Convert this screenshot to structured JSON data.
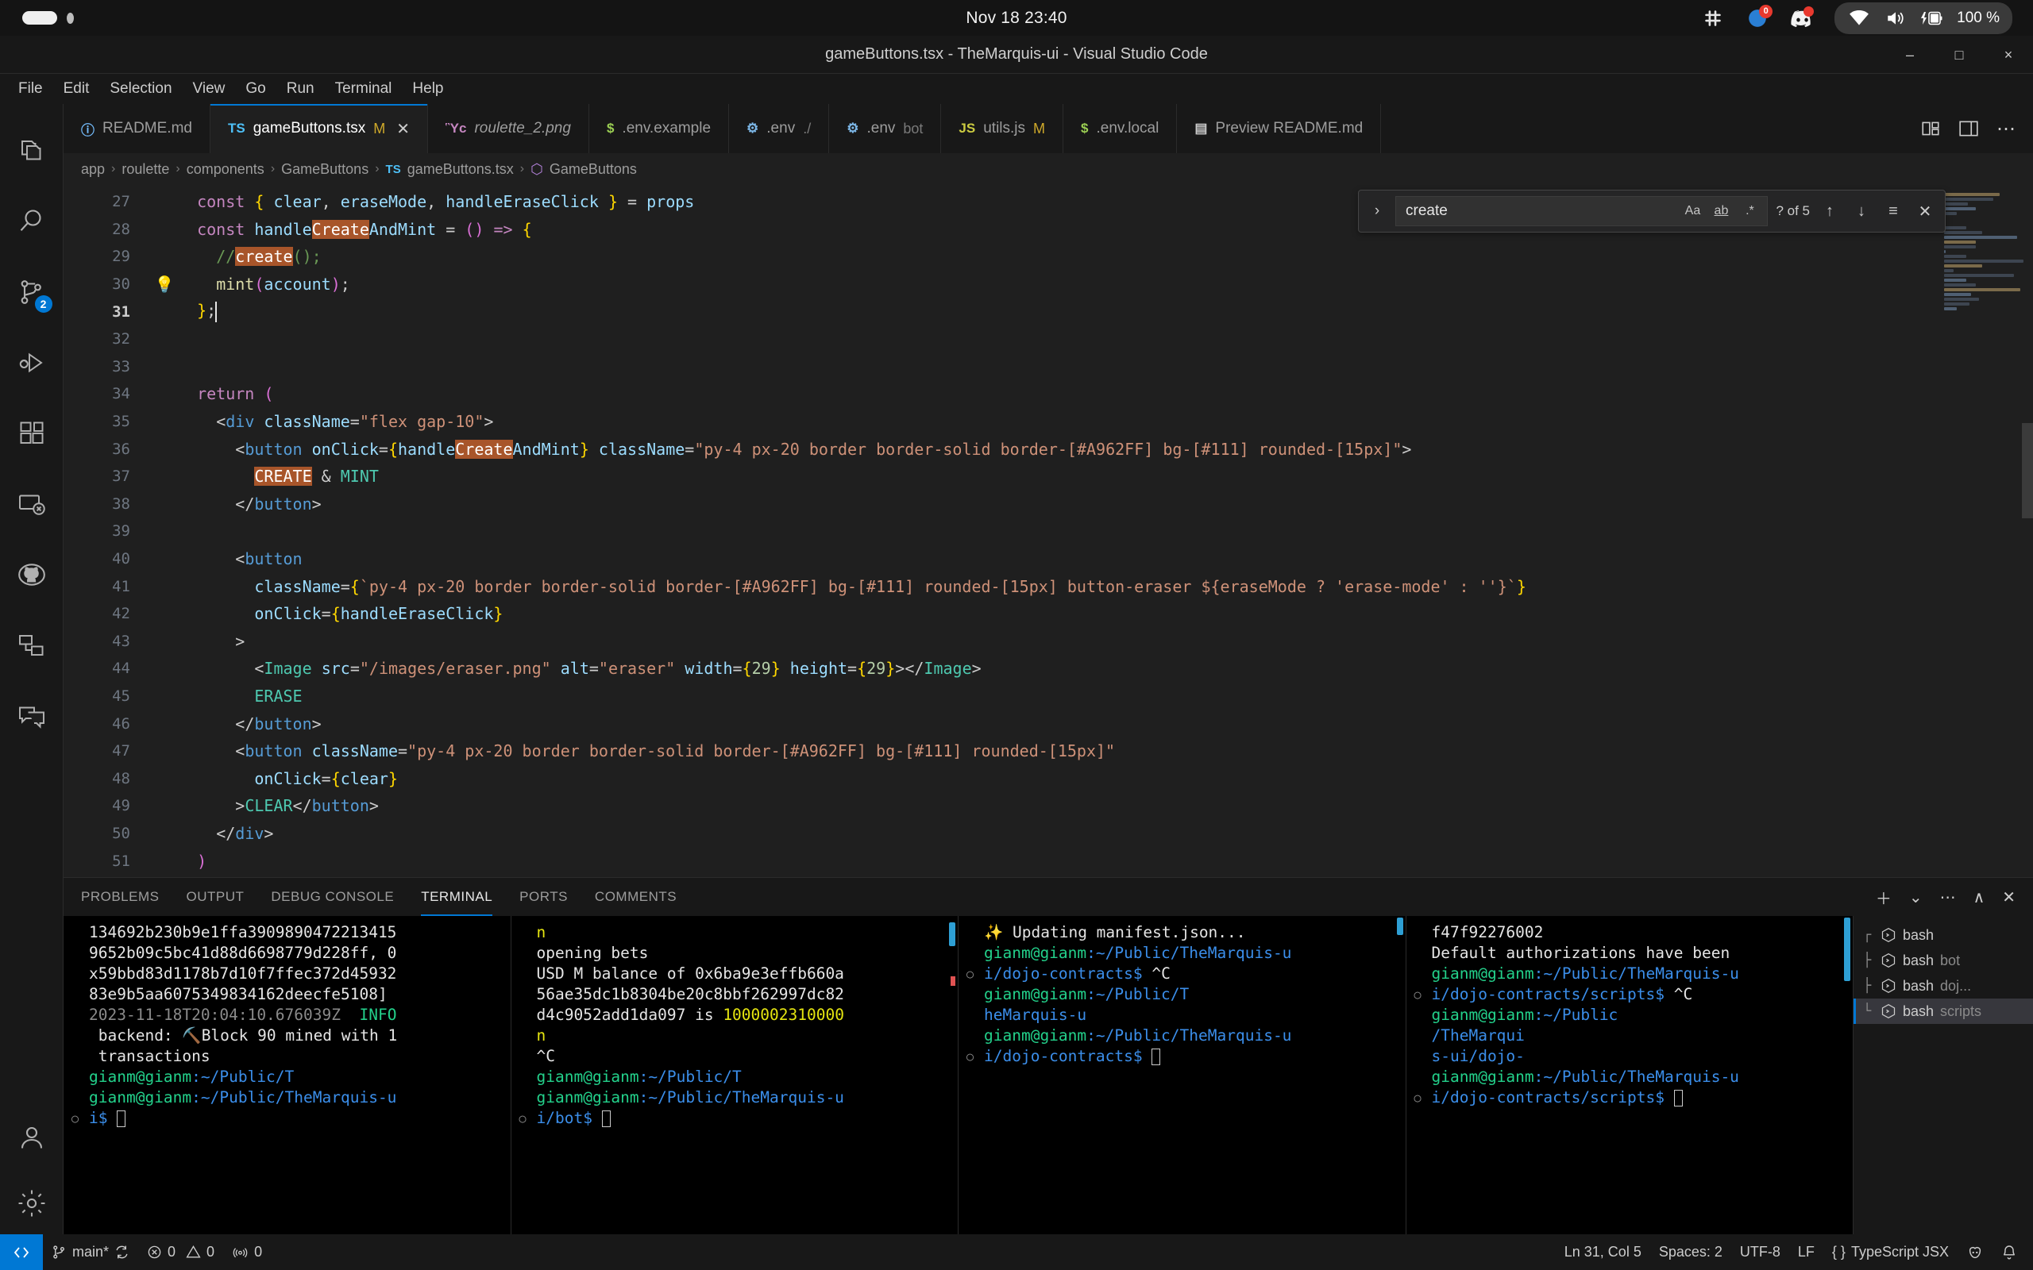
{
  "os_bar": {
    "clock": "Nov 18 23:40",
    "tray": [
      {
        "name": "slack-icon",
        "badge": null
      },
      {
        "name": "notification-badge-icon",
        "badge": "0"
      },
      {
        "name": "discord-icon",
        "badge": ""
      },
      {
        "name": "wifi-icon",
        "badge": null
      },
      {
        "name": "volume-icon",
        "badge": null
      },
      {
        "name": "battery-icon",
        "badge": null
      }
    ],
    "battery_label": "100 %"
  },
  "window": {
    "title": "gameButtons.tsx - TheMarquis-ui - Visual Studio Code",
    "minimize": "–",
    "maximize": "□",
    "close": "×"
  },
  "menubar": [
    "File",
    "Edit",
    "Selection",
    "View",
    "Go",
    "Run",
    "Terminal",
    "Help"
  ],
  "activitybar": [
    {
      "name": "explorer-icon",
      "badge": null
    },
    {
      "name": "search-icon",
      "badge": null
    },
    {
      "name": "source-control-icon",
      "badge": "2"
    },
    {
      "name": "run-and-debug-icon",
      "badge": null
    },
    {
      "name": "extensions-icon",
      "badge": null
    },
    {
      "name": "remote-explorer-icon",
      "badge": null
    },
    {
      "name": "github-icon",
      "badge": null
    },
    {
      "name": "testing-icon",
      "badge": null
    },
    {
      "name": "comments-icon",
      "badge": null
    }
  ],
  "activitybar_bottom": [
    {
      "name": "accounts-icon"
    },
    {
      "name": "settings-gear-icon"
    }
  ],
  "tabs": [
    {
      "icon": "info-icon",
      "icon_text": "ⓘ",
      "icon_color": "#75beff",
      "name": "README.md",
      "modified": "",
      "desc": "",
      "active": false,
      "closable": false,
      "italic": false
    },
    {
      "icon": "typescript-icon",
      "icon_text": "TS",
      "icon_color": "#4ec0f7",
      "name": "gameButtons.tsx",
      "modified": "M",
      "desc": "",
      "active": true,
      "closable": true,
      "italic": false
    },
    {
      "icon": "image-icon",
      "icon_text": "Ὓc",
      "icon_color": "#c586c0",
      "name": "roulette_2.png",
      "modified": "",
      "desc": "",
      "active": false,
      "closable": false,
      "italic": true
    },
    {
      "icon": "env-icon",
      "icon_text": "$",
      "icon_color": "#9bcf53",
      "name": ".env.example",
      "modified": "",
      "desc": "",
      "active": false,
      "closable": false,
      "italic": false
    },
    {
      "icon": "gear-icon",
      "icon_text": "⚙",
      "icon_color": "#7cb7e8",
      "name": ".env",
      "modified": "",
      "desc": "./",
      "active": false,
      "closable": false,
      "italic": false
    },
    {
      "icon": "gear-icon",
      "icon_text": "⚙",
      "icon_color": "#7cb7e8",
      "name": ".env",
      "modified": "",
      "desc": "bot",
      "active": false,
      "closable": false,
      "italic": false
    },
    {
      "icon": "javascript-icon",
      "icon_text": "JS",
      "icon_color": "#cbcb41",
      "name": "utils.js",
      "modified": "M",
      "desc": "",
      "active": false,
      "closable": false,
      "italic": false
    },
    {
      "icon": "env-icon",
      "icon_text": "$",
      "icon_color": "#9bcf53",
      "name": ".env.local",
      "modified": "",
      "desc": "",
      "active": false,
      "closable": false,
      "italic": false
    },
    {
      "icon": "preview-icon",
      "icon_text": "▤",
      "icon_color": "#cccccc",
      "name": "Preview README.md",
      "modified": "",
      "desc": "",
      "active": false,
      "closable": false,
      "italic": false
    }
  ],
  "tabbar_actions": [
    {
      "name": "split-editor-icon"
    },
    {
      "name": "toggle-layout-icon"
    },
    {
      "name": "more-actions-icon"
    }
  ],
  "breadcrumb": [
    "app",
    "roulette",
    "components",
    "GameButtons",
    "gameButtons.tsx",
    "GameButtons"
  ],
  "find_widget": {
    "toggle_replace": "›",
    "query": "create",
    "match_case": "Aa",
    "whole_word": "ab",
    "regex": ".*",
    "results": "? of 5",
    "prev": "↑",
    "next": "↓",
    "find_in_selection": "≡",
    "close": "✕"
  },
  "editor": {
    "first_line": 27,
    "current_line": 31,
    "lines": [
      {
        "n": 27,
        "text": "  const { clear, eraseMode, handleEraseClick } = props"
      },
      {
        "n": 28,
        "text": "  const handleCreateAndMint = () => {"
      },
      {
        "n": 29,
        "text": "    //create();"
      },
      {
        "n": 30,
        "text": "    mint(account);"
      },
      {
        "n": 31,
        "text": "  };"
      },
      {
        "n": 32,
        "text": ""
      },
      {
        "n": 33,
        "text": ""
      },
      {
        "n": 34,
        "text": "  return ("
      },
      {
        "n": 35,
        "text": "    <div className=\"flex gap-10\">"
      },
      {
        "n": 36,
        "text": "      <button onClick={handleCreateAndMint} className=\"py-4 px-20 border border-solid border-[#A962FF] bg-[#111] rounded-[15px]\">"
      },
      {
        "n": 37,
        "text": "        CREATE & MINT"
      },
      {
        "n": 38,
        "text": "      </button>"
      },
      {
        "n": 39,
        "text": ""
      },
      {
        "n": 40,
        "text": "      <button"
      },
      {
        "n": 41,
        "text": "        className={`py-4 px-20 border border-solid border-[#A962FF] bg-[#111] rounded-[15px] button-eraser ${eraseMode ? 'erase-mode' : ''}`}"
      },
      {
        "n": 42,
        "text": "        onClick={handleEraseClick}"
      },
      {
        "n": 43,
        "text": "      >"
      },
      {
        "n": 44,
        "text": "        <Image src=\"/images/eraser.png\" alt=\"eraser\" width={29} height={29}></Image>"
      },
      {
        "n": 45,
        "text": "        ERASE"
      },
      {
        "n": 46,
        "text": "      </button>"
      },
      {
        "n": 47,
        "text": "      <button className=\"py-4 px-20 border border-solid border-[#A962FF] bg-[#111] rounded-[15px]\""
      },
      {
        "n": 48,
        "text": "        onClick={clear}"
      },
      {
        "n": 49,
        "text": "      >CLEAR</button>"
      },
      {
        "n": 50,
        "text": "    </div>"
      },
      {
        "n": 51,
        "text": "  )"
      }
    ],
    "lightbulb_line": 30
  },
  "panel": {
    "tabs": [
      {
        "label": "PROBLEMS",
        "active": false
      },
      {
        "label": "OUTPUT",
        "active": false
      },
      {
        "label": "DEBUG CONSOLE",
        "active": false
      },
      {
        "label": "TERMINAL",
        "active": true
      },
      {
        "label": "PORTS",
        "active": false
      },
      {
        "label": "COMMENTS",
        "active": false
      }
    ],
    "actions": [
      {
        "name": "new-terminal-icon",
        "glyph": "＋"
      },
      {
        "name": "terminal-dropdown-icon",
        "glyph": "⌄"
      },
      {
        "name": "panel-more-actions-icon",
        "glyph": "⋯"
      },
      {
        "name": "maximize-panel-icon",
        "glyph": "∧"
      },
      {
        "name": "close-panel-icon",
        "glyph": "✕"
      }
    ]
  },
  "terminals": [
    {
      "name": "bash",
      "lines": [
        [
          {
            "t": "134692b230b9e1ffa3909890472213415",
            "c": "t-white"
          }
        ],
        [
          {
            "t": "9652b09c5bc41d88d6698779d228ff, 0",
            "c": "t-white"
          }
        ],
        [
          {
            "t": "x59bbd83d1178b7d10f7ffec372d45932",
            "c": "t-white"
          }
        ],
        [
          {
            "t": "83e9b5aa6075349834162deecfe5108]",
            "c": "t-white"
          }
        ],
        [
          {
            "t": "2023-11-18T20:04:10.676039Z ",
            "c": "t-gray"
          },
          {
            "t": " INFO",
            "c": "t-green"
          }
        ],
        [
          {
            "t": " backend: ⛏️Block 90 mined with 1",
            "c": "t-white"
          }
        ],
        [
          {
            "t": " transactions",
            "c": "t-white"
          }
        ],
        [
          {
            "t": "gianm@gianm",
            "c": "t-green"
          },
          {
            "t": ":~/Public/T",
            "c": "t-blue"
          }
        ],
        [
          {
            "t": "gianm@gianm",
            "c": "t-green"
          },
          {
            "t": ":~/Public/TheMarquis-u",
            "c": "t-blue"
          }
        ],
        [
          {
            "t": "i$ ",
            "c": "t-blue",
            "mark": true,
            "cursor": true
          }
        ]
      ]
    },
    {
      "name": "bash bot",
      "lines": [
        [
          {
            "t": "n",
            "c": "t-yellow"
          }
        ],
        [
          {
            "t": "opening bets",
            "c": "t-white"
          }
        ],
        [
          {
            "t": "USD M balance of 0x6ba9e3effb660a",
            "c": "t-white"
          }
        ],
        [
          {
            "t": "56ae35dc1b8304be20c8bbf262997dc82",
            "c": "t-white"
          }
        ],
        [
          {
            "t": "d4c9052add1da097 is ",
            "c": "t-white"
          },
          {
            "t": "1000002310000",
            "c": "t-yellow"
          }
        ],
        [
          {
            "t": "n",
            "c": "t-yellow"
          }
        ],
        [
          {
            "t": "^C",
            "c": "t-white"
          }
        ],
        [
          {
            "t": "gianm@gianm",
            "c": "t-green"
          },
          {
            "t": ":~/Public/T",
            "c": "t-blue"
          }
        ],
        [
          {
            "t": "gianm@gianm",
            "c": "t-green"
          },
          {
            "t": ":~/Public/TheMarquis-u",
            "c": "t-blue"
          }
        ],
        [
          {
            "t": "i/bot$ ",
            "c": "t-blue",
            "mark": true,
            "cursor": true
          }
        ]
      ]
    },
    {
      "name": "bash doj...",
      "lines": [
        [
          {
            "t": "",
            "c": "t-white"
          }
        ],
        [
          {
            "t": "✨ Updating manifest.json...",
            "c": "t-white"
          }
        ],
        [
          {
            "t": "",
            "c": "t-white"
          }
        ],
        [
          {
            "t": "gianm@gianm",
            "c": "t-green"
          },
          {
            "t": ":~/Public/TheMarquis-u",
            "c": "t-blue"
          }
        ],
        [
          {
            "t": "i/dojo-contracts$ ",
            "c": "t-blue",
            "mark": true
          },
          {
            "t": "^C",
            "c": "t-white"
          }
        ],
        [
          {
            "t": "gianm@gianm",
            "c": "t-green"
          },
          {
            "t": ":~/Public/T",
            "c": "t-blue"
          }
        ],
        [
          {
            "t": "heMarquis-u",
            "c": "t-blue"
          }
        ],
        [
          {
            "t": "gianm@gianm",
            "c": "t-green"
          },
          {
            "t": ":~/Public/TheMarquis-u",
            "c": "t-blue"
          }
        ],
        [
          {
            "t": "i/dojo-contracts$ ",
            "c": "t-blue",
            "mark": true,
            "cursor": true
          }
        ]
      ]
    },
    {
      "name": "bash scripts",
      "lines": [
        [
          {
            "t": "f47f92276002",
            "c": "t-white"
          }
        ],
        [
          {
            "t": "Default authorizations have been",
            "c": "t-white"
          }
        ],
        [
          {
            "t": "gianm@gianm",
            "c": "t-green"
          },
          {
            "t": ":~/Public/TheMarquis-u",
            "c": "t-blue"
          }
        ],
        [
          {
            "t": "i/dojo-contracts/scripts$ ",
            "c": "t-blue",
            "mark": true
          },
          {
            "t": "^C",
            "c": "t-white"
          }
        ],
        [
          {
            "t": "gianm@gianm",
            "c": "t-green"
          },
          {
            "t": ":~/Public",
            "c": "t-blue"
          }
        ],
        [
          {
            "t": "/TheMarqui",
            "c": "t-blue"
          }
        ],
        [
          {
            "t": "s-ui/dojo-",
            "c": "t-blue"
          }
        ],
        [
          {
            "t": "gianm@gianm",
            "c": "t-green"
          },
          {
            "t": ":~/Public/TheMarquis-u",
            "c": "t-blue"
          }
        ],
        [
          {
            "t": "i/dojo-contracts/scripts$ ",
            "c": "t-blue",
            "mark": true,
            "cursor": true
          }
        ]
      ]
    }
  ],
  "terminal_list": [
    {
      "tree": "┌",
      "label": "bash",
      "desc": "",
      "active": false
    },
    {
      "tree": "├",
      "label": "bash",
      "desc": "bot",
      "active": false
    },
    {
      "tree": "├",
      "label": "bash",
      "desc": "doj...",
      "active": false
    },
    {
      "tree": "└",
      "label": "bash",
      "desc": "scripts",
      "active": true
    }
  ],
  "statusbar": {
    "remote_icon": "remote-window-icon",
    "branch": "main*",
    "sync_icon": "sync-icon",
    "errors": "0",
    "warnings": "0",
    "ports": "0",
    "position": "Ln 31, Col 5",
    "indentation": "Spaces: 2",
    "encoding": "UTF-8",
    "eol": "LF",
    "language": "TypeScript JSX",
    "prettier_icon": "prettier-icon",
    "bell_icon": "bell-icon"
  }
}
